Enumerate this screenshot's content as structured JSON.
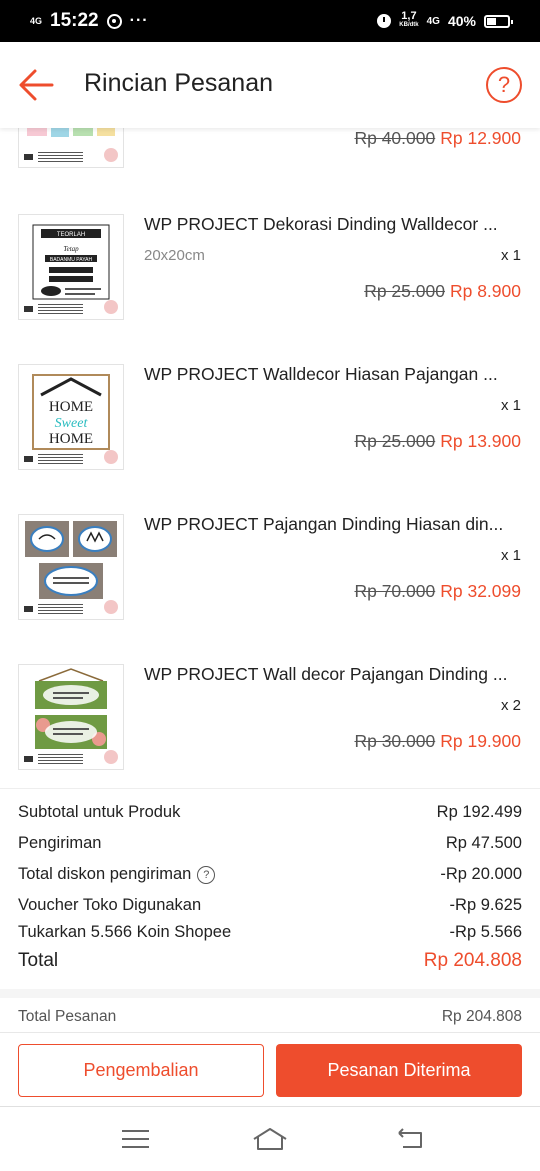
{
  "status_bar": {
    "network_left": "4G",
    "time": "15:22",
    "more": "···",
    "speed_value": "1,7",
    "speed_unit": "KB/dtk",
    "network_right": "4G",
    "battery": "40%"
  },
  "header": {
    "title": "Rincian Pesanan",
    "help": "?"
  },
  "products": [
    {
      "name": "",
      "variant": "",
      "qty": "",
      "price_old": "Rp 40.000",
      "price_new": "Rp 12.900",
      "thumb_icon": "baby-clothes-wall-decor-thumbnail"
    },
    {
      "name": "WP PROJECT Dekorasi Dinding Walldecor ...",
      "variant": "20x20cm",
      "qty": "x 1",
      "price_old": "Rp 25.000",
      "price_new": "Rp 8.900",
      "thumb_icon": "quote-wall-decor-thumbnail"
    },
    {
      "name": "WP PROJECT Walldecor Hiasan Pajangan ...",
      "variant": "",
      "qty": "x 1",
      "price_old": "Rp 25.000",
      "price_new": "Rp 13.900",
      "thumb_icon": "home-sweet-home-thumbnail"
    },
    {
      "name": "WP PROJECT Pajangan Dinding Hiasan din...",
      "variant": "",
      "qty": "x 1",
      "price_old": "Rp 70.000",
      "price_new": "Rp 32.099",
      "thumb_icon": "calligraphy-wall-decor-thumbnail"
    },
    {
      "name": "WP PROJECT Wall decor Pajangan Dinding ...",
      "variant": "",
      "qty": "x 2",
      "price_old": "Rp 30.000",
      "price_new": "Rp 19.900",
      "thumb_icon": "hanging-sign-wall-decor-thumbnail"
    }
  ],
  "summary": {
    "subtotal_label": "Subtotal untuk Produk",
    "subtotal_value": "Rp 192.499",
    "shipping_label": "Pengiriman",
    "shipping_value": "Rp 47.500",
    "shipping_discount_label": "Total diskon pengiriman",
    "shipping_discount_value": "-Rp 20.000",
    "voucher_label": "Voucher Toko Digunakan",
    "voucher_value": "-Rp 9.625",
    "coins_label": "Tukarkan 5.566 Koin Shopee",
    "coins_value": "-Rp 5.566",
    "total_label": "Total",
    "total_value": "Rp 204.808"
  },
  "order_total": {
    "label": "Total Pesanan",
    "value": "Rp 204.808"
  },
  "actions": {
    "return_label": "Pengembalian",
    "received_label": "Pesanan Diterima"
  },
  "thumb_text": {
    "quote_1": "TEORLAH",
    "quote_2": "BADANMU PAYAH",
    "home_1": "HOME",
    "home_2": "Sweet",
    "home_3": "HOME"
  },
  "colors": {
    "accent": "#ee4d2d",
    "text": "#222222",
    "muted": "#888888"
  }
}
